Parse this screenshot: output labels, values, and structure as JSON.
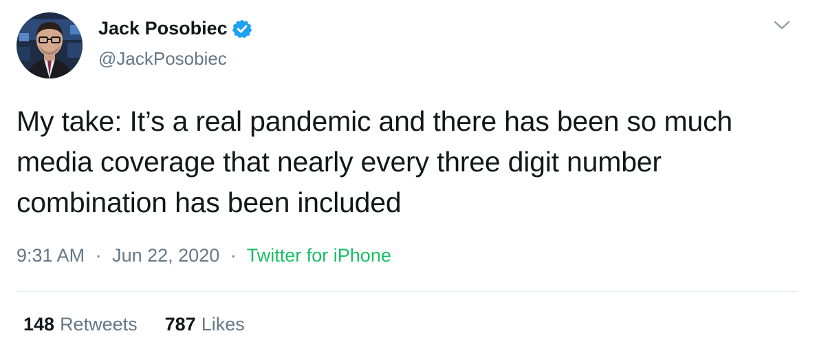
{
  "author": {
    "display_name": "Jack Posobiec",
    "handle": "@JackPosobiec",
    "verified": true,
    "verified_color": "#1da1f2"
  },
  "tweet": {
    "text": "My take: It’s a real pandemic and there has been so much media coverage that nearly every three digit number combination has been included",
    "time": "9:31 AM",
    "date": "Jun 22, 2020",
    "separator": "·",
    "source": "Twitter for iPhone",
    "source_color": "#17bf63"
  },
  "stats": {
    "retweets_count": "148",
    "retweets_label": "Retweets",
    "likes_count": "787",
    "likes_label": "Likes"
  },
  "icons": {
    "verified": "verified-badge-icon",
    "menu": "chevron-down-icon"
  }
}
